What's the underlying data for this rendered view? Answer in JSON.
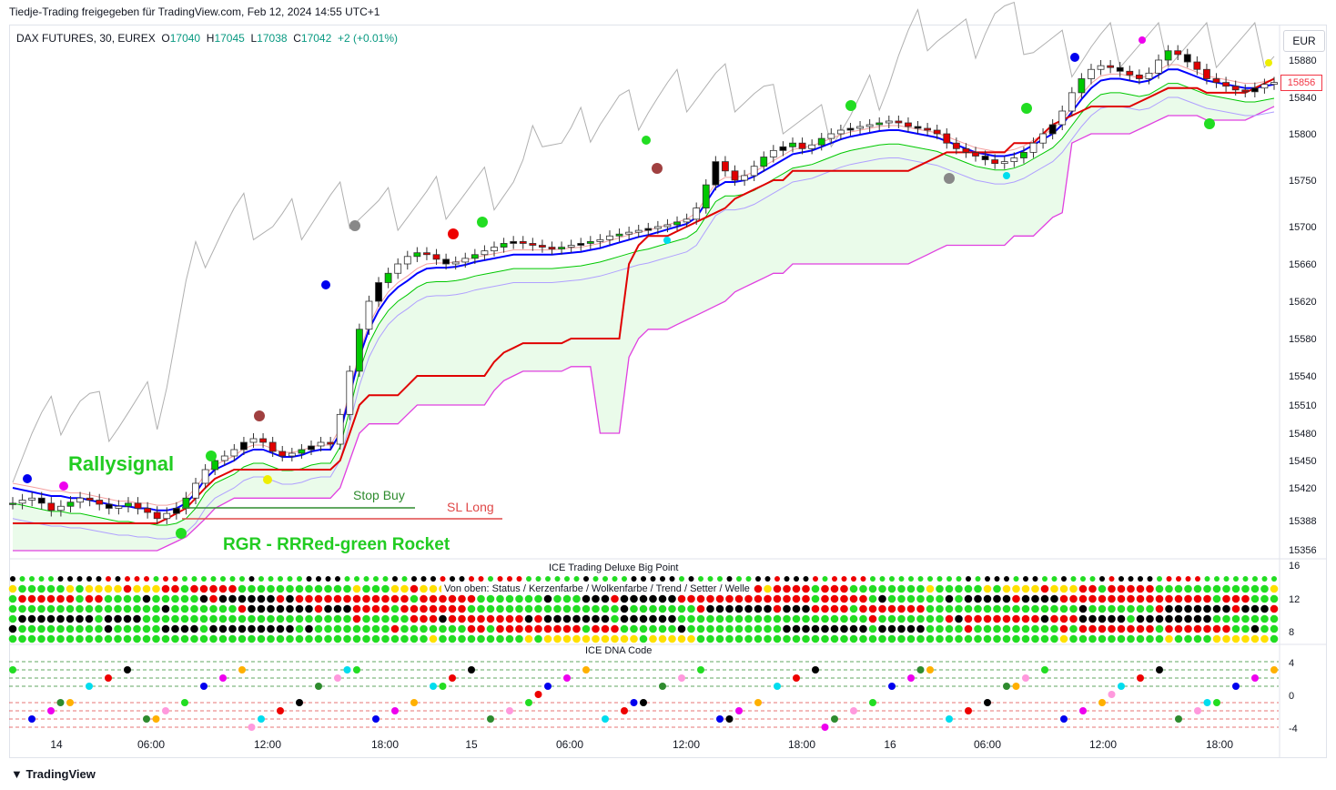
{
  "header": {
    "share_note": "Tiedje-Trading freigegeben für TradingView.com, Feb 12, 2024 14:55 UTC+1",
    "symbol": "DAX FUTURES, 30, EUREX",
    "o_label": "O",
    "o_value": "17040",
    "h_label": "H",
    "h_value": "17045",
    "l_label": "L",
    "l_value": "17038",
    "c_label": "C",
    "c_value": "17042",
    "change": "+2 (+0.01%)",
    "currency": "EUR",
    "last_price": "15856"
  },
  "annotations": {
    "rallysignal": "Rallysignal",
    "stop_buy": "Stop Buy",
    "sl_long": "SL Long",
    "rgr": "RGR - RRRed-green Rocket"
  },
  "panels": {
    "big_point_title": "ICE Trading Deluxe Big Point",
    "big_point_subtitle": "Von oben: Status / Kerzenfarbe / Wolkenfarbe / Trend / Setter / Welle",
    "dna_title": "ICE DNA Code",
    "big_point_axis": [
      "16",
      "12",
      "8"
    ],
    "dna_axis": [
      "4",
      "0",
      "-4"
    ]
  },
  "branding": {
    "logo": "TradingView"
  },
  "colors": {
    "up": "#00c800",
    "down": "#e00000",
    "blue_line": "#0000ff",
    "red_line": "#e00000",
    "magenta_line": "#e040e0",
    "green_line": "#00c800",
    "cloud": "#eafbea",
    "shadow": "#b0b0b0"
  },
  "chart_data": {
    "type": "candlestick",
    "title": "DAX FUTURES, 30, EUREX",
    "x_ticks": [
      "14",
      "06:00",
      "12:00",
      "18:00",
      "15",
      "06:00",
      "12:00",
      "18:00",
      "16",
      "06:00",
      "12:00",
      "18:00"
    ],
    "y_ticks": [
      15356,
      15388,
      15420,
      15450,
      15480,
      15510,
      15540,
      15580,
      15620,
      15660,
      15700,
      15750,
      15800,
      15840,
      15880
    ],
    "ylim": [
      15340,
      15900
    ],
    "close_series": [
      15405,
      15408,
      15410,
      15405,
      15398,
      15402,
      15406,
      15410,
      15408,
      15404,
      15400,
      15402,
      15405,
      15400,
      15396,
      15390,
      15395,
      15400,
      15410,
      15425,
      15440,
      15450,
      15455,
      15462,
      15470,
      15474,
      15470,
      15460,
      15455,
      15458,
      15462,
      15466,
      15470,
      15468,
      15500,
      15545,
      15590,
      15620,
      15640,
      15650,
      15660,
      15668,
      15672,
      15670,
      15665,
      15660,
      15662,
      15666,
      15670,
      15674,
      15678,
      15682,
      15684,
      15682,
      15680,
      15678,
      15676,
      15678,
      15680,
      15682,
      15684,
      15686,
      15690,
      15692,
      15694,
      15696,
      15698,
      15700,
      15702,
      15705,
      15708,
      15720,
      15745,
      15770,
      15760,
      15750,
      15755,
      15765,
      15775,
      15782,
      15786,
      15790,
      15784,
      15788,
      15795,
      15800,
      15804,
      15806,
      15808,
      15810,
      15812,
      15814,
      15812,
      15808,
      15806,
      15804,
      15800,
      15790,
      15784,
      15780,
      15776,
      15772,
      15768,
      15770,
      15774,
      15780,
      15790,
      15800,
      15810,
      15825,
      15845,
      15860,
      15870,
      15874,
      15872,
      15868,
      15864,
      15860,
      15866,
      15880,
      15890,
      15886,
      15878,
      15870,
      15860,
      15856,
      15852,
      15848,
      15846,
      15850,
      15854,
      15856
    ],
    "series": [
      {
        "name": "",
        "values": [
          15420,
          15418,
          15416,
          15414,
          15412,
          15412,
          15410,
          15410,
          15408,
          15406,
          15404,
          15402,
          15402,
          15400,
          15400,
          15398,
          15398,
          15400,
          15405,
          15415,
          15430,
          15440,
          15445,
          15450,
          15458,
          15462,
          15462,
          15458,
          15454,
          15454,
          15456,
          15460,
          15462,
          15462,
          15480,
          15520,
          15560,
          15590,
          15610,
          15625,
          15635,
          15642,
          15650,
          15655,
          15656,
          15656,
          15657,
          15659,
          15662,
          15664,
          15666,
          15668,
          15670,
          15670,
          15670,
          15670,
          15670,
          15671,
          15672,
          15673,
          15675,
          15677,
          15680,
          15683,
          15686,
          15689,
          15691,
          15694,
          15697,
          15700,
          15703,
          15710,
          15726,
          15742,
          15748,
          15748,
          15750,
          15754,
          15760,
          15766,
          15772,
          15778,
          15780,
          15782,
          15786,
          15790,
          15794,
          15797,
          15799,
          15801,
          15803,
          15804,
          15804,
          15802,
          15800,
          15798,
          15796,
          15792,
          15788,
          15784,
          15780,
          15778,
          15776,
          15776,
          15778,
          15782,
          15788,
          15794,
          15800,
          15810,
          15824,
          15838,
          15850,
          15858,
          15860,
          15860,
          15858,
          15856,
          15858,
          15864,
          15870,
          15870,
          15866,
          15862,
          15858,
          15856,
          15854,
          15852,
          15850,
          15850,
          15852,
          15854
        ]
      },
      {
        "name": "",
        "values": [
          15385,
          15385,
          15385,
          15385,
          15385,
          15385,
          15385,
          15385,
          15385,
          15385,
          15385,
          15385,
          15385,
          15385,
          15385,
          15385,
          15390,
          15395,
          15400,
          15410,
          15420,
          15430,
          15435,
          15440,
          15440,
          15440,
          15440,
          15440,
          15440,
          15440,
          15440,
          15440,
          15440,
          15440,
          15450,
          15480,
          15510,
          15520,
          15520,
          15520,
          15520,
          15530,
          15540,
          15540,
          15540,
          15540,
          15540,
          15540,
          15540,
          15540,
          15555,
          15565,
          15570,
          15575,
          15575,
          15575,
          15575,
          15575,
          15580,
          15580,
          15580,
          15580,
          15580,
          15580,
          15660,
          15680,
          15690,
          15690,
          15690,
          15695,
          15700,
          15705,
          15710,
          15715,
          15720,
          15730,
          15735,
          15740,
          15745,
          15750,
          15750,
          15760,
          15760,
          15760,
          15760,
          15760,
          15760,
          15760,
          15760,
          15760,
          15760,
          15760,
          15760,
          15760,
          15765,
          15770,
          15775,
          15780,
          15780,
          15780,
          15780,
          15780,
          15780,
          15780,
          15790,
          15790,
          15790,
          15800,
          15810,
          15815,
          15820,
          15825,
          15830,
          15830,
          15830,
          15830,
          15830,
          15835,
          15840,
          15845,
          15850,
          15850,
          15850,
          15850,
          15845,
          15845,
          15845,
          15845,
          15845,
          15850,
          15855,
          15860
        ]
      }
    ]
  }
}
